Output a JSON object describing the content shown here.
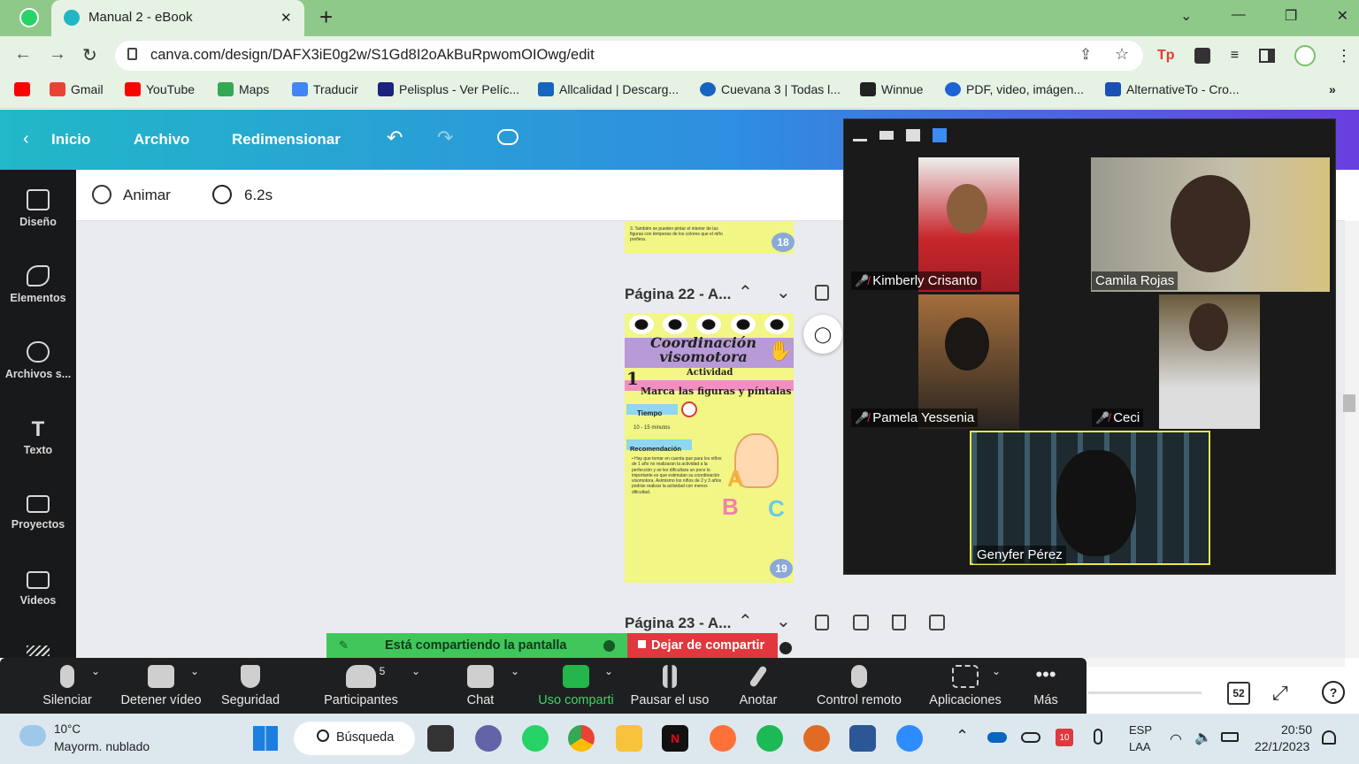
{
  "browser": {
    "tab_title": "Manual 2 - eBook",
    "new_tab": "+",
    "close_tab": "✕",
    "url": "canva.com/design/DAFX3iE0g2w/S1Gd8I2oAkBuRpwomOIOwg/edit",
    "bookmarks": [
      {
        "label": "Gmail",
        "color": "#ea4335"
      },
      {
        "label": "YouTube",
        "color": "#ff0000"
      },
      {
        "label": "Maps",
        "color": "#34a853"
      },
      {
        "label": "Traducir",
        "color": "#4285f4"
      },
      {
        "label": "Pelisplus - Ver Pelíc...",
        "color": "#1a237e"
      },
      {
        "label": "Allcalidad | Descarg...",
        "color": "#1565c0"
      },
      {
        "label": "Cuevana 3 | Todas l...",
        "color": "#1565c0"
      },
      {
        "label": "Winnue",
        "color": "#222222"
      },
      {
        "label": "PDF, video, imágen...",
        "color": "#1e63d6"
      },
      {
        "label": "AlternativeTo - Cro...",
        "color": "#1a4fb5"
      }
    ],
    "more": "»"
  },
  "canva": {
    "back": "Inicio",
    "file": "Archivo",
    "resize": "Redimensionar",
    "animate": "Animar",
    "duration": "6.2s",
    "sidebar": [
      {
        "label": "Diseño",
        "icon": "layout-icon"
      },
      {
        "label": "Elementos",
        "icon": "shapes-icon"
      },
      {
        "label": "Archivos s...",
        "icon": "cloud-upload-icon"
      },
      {
        "label": "Texto",
        "icon": "text-icon"
      },
      {
        "label": "Proyectos",
        "icon": "folder-icon"
      },
      {
        "label": "Videos",
        "icon": "video-icon"
      }
    ],
    "page22_label": "Página 22 - A...",
    "page23_label": "Página 23 - A...",
    "prev_page_number": "18",
    "prev_page_text": "3. También se pueden pintar el interior de las figuras con témperas de los colores que el niño prefiera.",
    "page": {
      "title": "Coordinación visomotora",
      "activity": "Actividad",
      "number": "1",
      "instruction": "Marca las figuras y píntalas",
      "time_label": "Tiempo",
      "time_value": "10 - 15 minutos",
      "rec_label": "Recomendación",
      "rec_text": "• Hay que tomar en cuenta que para los niños de 1 año no realizaran la actividad a la perfección y se les dificultara un poco lo importante es que estimulan su coordinación visomotora. Asimismo los niños de 2 y 3 años podrán realizar la actividad con menos dificultad.",
      "page_number": "19",
      "colors": {
        "bg": "#f1f685",
        "title_bar": "#b89ad8",
        "stripe": "#f28fc2",
        "tag": "#8fd6f0"
      }
    }
  },
  "zoom": {
    "participants": [
      {
        "name": "Kimberly Crisanto",
        "muted": true
      },
      {
        "name": "Camila Rojas",
        "muted": false
      },
      {
        "name": "Pamela Yessenia",
        "muted": true
      },
      {
        "name": "Ceci",
        "muted": true
      },
      {
        "name": "Genyfer Pérez",
        "muted": false
      }
    ],
    "share_banner": "Está compartiendo la pantalla",
    "stop_share": "Dejar de compartir",
    "participant_count": "5",
    "toolbar": [
      {
        "label": "Silenciar",
        "icon": "microphone-icon"
      },
      {
        "label": "Detener vídeo",
        "icon": "camera-icon"
      },
      {
        "label": "Seguridad",
        "icon": "shield-icon"
      },
      {
        "label": "Participantes",
        "icon": "participants-icon"
      },
      {
        "label": "Chat",
        "icon": "chat-icon"
      },
      {
        "label": "Uso comparti",
        "icon": "share-screen-icon"
      },
      {
        "label": "Pausar el uso",
        "icon": "pause-icon"
      },
      {
        "label": "Anotar",
        "icon": "pencil-icon"
      },
      {
        "label": "Control remoto",
        "icon": "mouse-icon"
      },
      {
        "label": "Aplicaciones",
        "icon": "apps-icon"
      },
      {
        "label": "Más",
        "icon": "more-icon"
      }
    ],
    "page_badge": "52"
  },
  "taskbar": {
    "weather_temp": "10°C",
    "weather_desc": "Mayorm. nublado",
    "search": "Búsqueda",
    "lang1": "ESP",
    "lang2": "LAA",
    "time": "20:50",
    "date": "22/1/2023",
    "calendar_badge": "10"
  }
}
